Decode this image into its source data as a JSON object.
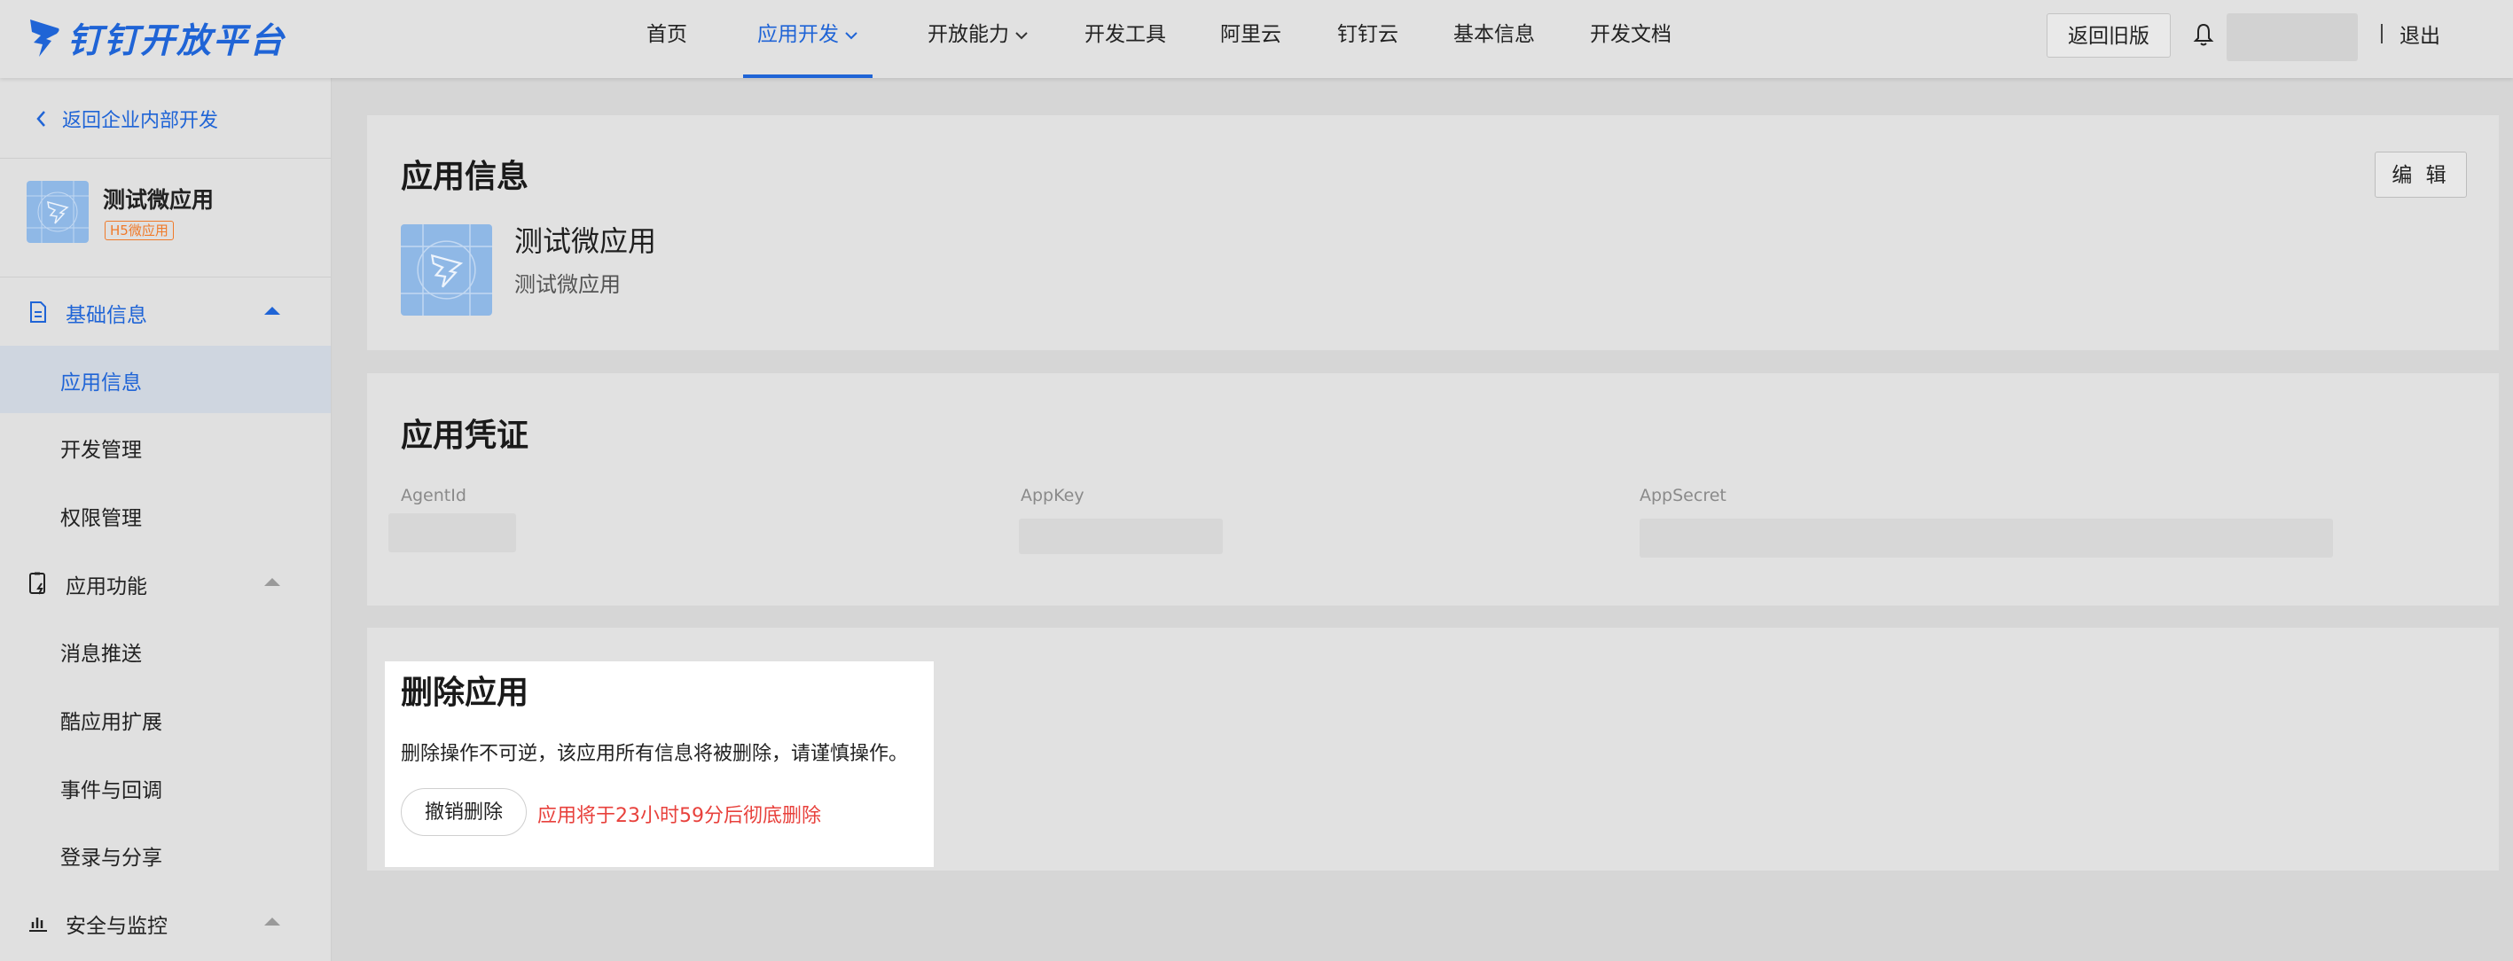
{
  "header": {
    "logo_text": "钉钉开放平台",
    "nav": [
      "首页",
      "应用开发",
      "开放能力",
      "开发工具",
      "阿里云",
      "钉钉云",
      "基本信息",
      "开发文档"
    ],
    "active_nav": "应用开发",
    "back_old_label": "返回旧版",
    "logout_label": "退出",
    "accent_color": "#1f64d6"
  },
  "sidebar": {
    "back_label": "返回企业内部开发",
    "app_name": "测试微应用",
    "app_badge": "H5微应用",
    "groups": [
      {
        "label": "基础信息",
        "icon": "document-icon",
        "expanded": true,
        "active": true,
        "items": [
          "应用信息",
          "开发管理",
          "权限管理"
        ],
        "active_item": "应用信息"
      },
      {
        "label": "应用功能",
        "icon": "mobile-bolt-icon",
        "expanded": true,
        "items": [
          "消息推送",
          "酷应用扩展",
          "事件与回调",
          "登录与分享"
        ]
      },
      {
        "label": "安全与监控",
        "icon": "bar-chart-icon",
        "expanded": true,
        "items": []
      }
    ]
  },
  "app_info": {
    "title": "应用信息",
    "edit_label": "编 辑",
    "name": "测试微应用",
    "description": "测试微应用"
  },
  "credentials": {
    "title": "应用凭证",
    "fields": [
      "AgentId",
      "AppKey",
      "AppSecret"
    ]
  },
  "delete_app": {
    "title": "删除应用",
    "warning": "删除操作不可逆，该应用所有信息将被删除，请谨慎操作。",
    "undo_label": "撤销删除",
    "status": "应用将于23小时59分后彻底删除",
    "status_color": "#e8413c"
  }
}
